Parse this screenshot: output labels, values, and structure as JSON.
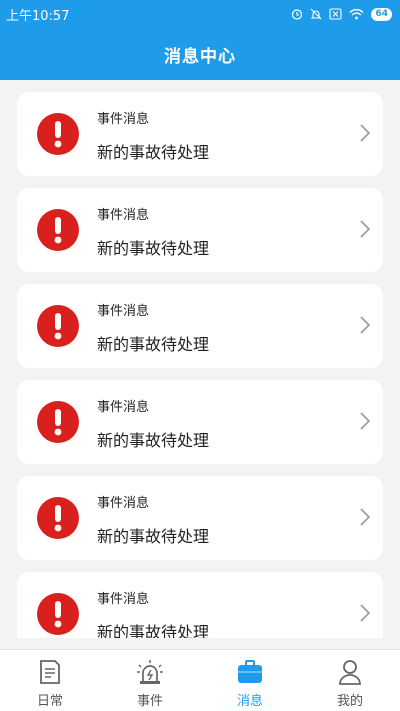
{
  "status_bar": {
    "time": "上午10:57",
    "battery": "64"
  },
  "header": {
    "title": "消息中心"
  },
  "messages": [
    {
      "title": "事件消息",
      "body": "新的事故待处理"
    },
    {
      "title": "事件消息",
      "body": "新的事故待处理"
    },
    {
      "title": "事件消息",
      "body": "新的事故待处理"
    },
    {
      "title": "事件消息",
      "body": "新的事故待处理"
    },
    {
      "title": "事件消息",
      "body": "新的事故待处理"
    },
    {
      "title": "事件消息",
      "body": "新的事故待处理"
    }
  ],
  "tabs": [
    {
      "label": "日常",
      "icon": "document-icon",
      "active": false
    },
    {
      "label": "事件",
      "icon": "alarm-light-icon",
      "active": false
    },
    {
      "label": "消息",
      "icon": "briefcase-icon",
      "active": true
    },
    {
      "label": "我的",
      "icon": "person-icon",
      "active": false
    }
  ],
  "colors": {
    "primary": "#1e9be9",
    "alert": "#d9201c",
    "background": "#f2f3f5"
  }
}
